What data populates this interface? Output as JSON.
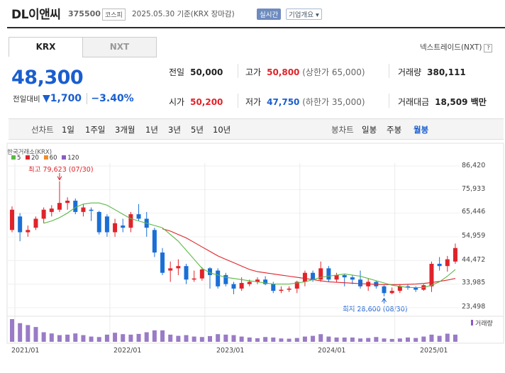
{
  "header": {
    "name": "DL이앤씨",
    "code": "375500",
    "market": "코스피",
    "date_text": "2025.05.30  기준(KRX 장마감)",
    "realtime_label": "실시간",
    "company_label": "기업개요 ▾"
  },
  "tabs": [
    {
      "label": "KRX"
    },
    {
      "label": "NXT"
    }
  ],
  "nxt_link": "넥스트레이드(NXT)",
  "nxt_link_icon": "?",
  "price": {
    "current": "48,300",
    "change_label": "전일대비",
    "change_arrow": "▼",
    "change_value": "1,700",
    "change_pct": "−3.40%"
  },
  "stats": {
    "prev_close": {
      "label": "전일",
      "value": "50,000"
    },
    "high": {
      "label": "고가",
      "value": "50,800",
      "sub": "(상한가 65,000)"
    },
    "volume": {
      "label": "거래량",
      "value": "380,111"
    },
    "open": {
      "label": "시가",
      "value": "50,200"
    },
    "low": {
      "label": "저가",
      "value": "47,750",
      "sub": "(하한가 35,000)"
    },
    "amount": {
      "label": "거래대금",
      "value": "18,509 백만"
    }
  },
  "toolbar": {
    "line_label": "선차트",
    "periods": [
      "1일",
      "1주일",
      "3개월",
      "1년",
      "3년",
      "5년",
      "10년"
    ],
    "candle_label": "봉차트",
    "candle_types": [
      "일봉",
      "주봉",
      "월봉"
    ],
    "selected_candle": "월봉"
  },
  "chart_data": {
    "type": "candlestick",
    "source_label": "한국거래소(KRX)",
    "ma_legend": [
      {
        "name": "5",
        "color": "#5ab946"
      },
      {
        "name": "20",
        "color": "#e0232a"
      },
      {
        "name": "60",
        "color": "#f08c2a"
      },
      {
        "name": "120",
        "color": "#8a5cc2"
      }
    ],
    "y_ticks": [
      "86,420",
      "75,933",
      "65,446",
      "54,959",
      "44,472",
      "33,985",
      "23,498"
    ],
    "ylim": [
      23498,
      86420
    ],
    "x_ticks": [
      "2021/01",
      "2022/01",
      "2023/01",
      "2024/01",
      "2025/01"
    ],
    "high_annotation": "최고 79,623 (07/30)",
    "low_annotation": "최저 28,600 (08/30)",
    "volume_label": "거래량",
    "up_color": "#e0232a",
    "down_color": "#1a6fd6",
    "candles": [
      {
        "o": 58000,
        "c": 67000,
        "h": 68500,
        "l": 57000
      },
      {
        "o": 64000,
        "c": 57000,
        "h": 65500,
        "l": 53000
      },
      {
        "o": 57000,
        "c": 58000,
        "h": 60000,
        "l": 55000
      },
      {
        "o": 59000,
        "c": 63000,
        "h": 64000,
        "l": 58000
      },
      {
        "o": 63000,
        "c": 67000,
        "h": 68000,
        "l": 61000
      },
      {
        "o": 66000,
        "c": 67500,
        "h": 69000,
        "l": 64000
      },
      {
        "o": 67000,
        "c": 70000,
        "h": 79623,
        "l": 66000
      },
      {
        "o": 70000,
        "c": 71000,
        "h": 72500,
        "l": 67000
      },
      {
        "o": 71000,
        "c": 66000,
        "h": 72000,
        "l": 65000
      },
      {
        "o": 66000,
        "c": 68000,
        "h": 69500,
        "l": 64000
      },
      {
        "o": 67000,
        "c": 66500,
        "h": 68000,
        "l": 62000
      },
      {
        "o": 66000,
        "c": 57000,
        "h": 66500,
        "l": 56000
      },
      {
        "o": 64000,
        "c": 57000,
        "h": 65000,
        "l": 55000
      },
      {
        "o": 57000,
        "c": 61000,
        "h": 63000,
        "l": 55000
      },
      {
        "o": 60000,
        "c": 59000,
        "h": 63000,
        "l": 57000
      },
      {
        "o": 59000,
        "c": 65000,
        "h": 66000,
        "l": 57000
      },
      {
        "o": 65000,
        "c": 63000,
        "h": 69500,
        "l": 62000
      },
      {
        "o": 63000,
        "c": 59000,
        "h": 66000,
        "l": 55000
      },
      {
        "o": 58000,
        "c": 48000,
        "h": 59000,
        "l": 46000
      },
      {
        "o": 48000,
        "c": 39000,
        "h": 50000,
        "l": 38000
      },
      {
        "o": 40000,
        "c": 41000,
        "h": 44000,
        "l": 35000
      },
      {
        "o": 41000,
        "c": 42000,
        "h": 45000,
        "l": 38000
      },
      {
        "o": 42000,
        "c": 36000,
        "h": 43000,
        "l": 34000
      },
      {
        "o": 36000,
        "c": 36500,
        "h": 40000,
        "l": 35000
      },
      {
        "o": 36500,
        "c": 40500,
        "h": 41500,
        "l": 35500
      },
      {
        "o": 41000,
        "c": 38000,
        "h": 41500,
        "l": 32000
      },
      {
        "o": 40000,
        "c": 33000,
        "h": 41000,
        "l": 32000
      },
      {
        "o": 38000,
        "c": 34000,
        "h": 39000,
        "l": 33000
      },
      {
        "o": 34000,
        "c": 32000,
        "h": 35000,
        "l": 29500
      },
      {
        "o": 32000,
        "c": 34500,
        "h": 37000,
        "l": 31000
      },
      {
        "o": 34000,
        "c": 35000,
        "h": 36000,
        "l": 33000
      },
      {
        "o": 35000,
        "c": 36000,
        "h": 37000,
        "l": 34000
      },
      {
        "o": 36000,
        "c": 34000,
        "h": 37500,
        "l": 33500
      },
      {
        "o": 34000,
        "c": 31000,
        "h": 35000,
        "l": 30000
      },
      {
        "o": 31000,
        "c": 31500,
        "h": 33000,
        "l": 30000
      },
      {
        "o": 31500,
        "c": 32000,
        "h": 33000,
        "l": 30500
      },
      {
        "o": 32000,
        "c": 35000,
        "h": 35500,
        "l": 30000
      },
      {
        "o": 35000,
        "c": 39000,
        "h": 40000,
        "l": 33000
      },
      {
        "o": 39000,
        "c": 36000,
        "h": 40000,
        "l": 35000
      },
      {
        "o": 36000,
        "c": 41000,
        "h": 44000,
        "l": 35000
      },
      {
        "o": 41000,
        "c": 36000,
        "h": 42000,
        "l": 35000
      },
      {
        "o": 36000,
        "c": 38000,
        "h": 39000,
        "l": 35000
      },
      {
        "o": 38000,
        "c": 37000,
        "h": 38500,
        "l": 33000
      },
      {
        "o": 37000,
        "c": 36000,
        "h": 38000,
        "l": 34000
      },
      {
        "o": 36000,
        "c": 33000,
        "h": 40000,
        "l": 32000
      },
      {
        "o": 33000,
        "c": 35000,
        "h": 36500,
        "l": 31000
      },
      {
        "o": 35000,
        "c": 33000,
        "h": 35500,
        "l": 32000
      },
      {
        "o": 33000,
        "c": 30000,
        "h": 33500,
        "l": 28600
      },
      {
        "o": 30000,
        "c": 31000,
        "h": 32500,
        "l": 29500
      },
      {
        "o": 31000,
        "c": 33000,
        "h": 34000,
        "l": 30000
      },
      {
        "o": 33000,
        "c": 32500,
        "h": 34000,
        "l": 31500
      },
      {
        "o": 32500,
        "c": 31500,
        "h": 33000,
        "l": 30500
      },
      {
        "o": 31500,
        "c": 33500,
        "h": 34000,
        "l": 31000
      },
      {
        "o": 33000,
        "c": 43000,
        "h": 44000,
        "l": 30500
      },
      {
        "o": 43000,
        "c": 42000,
        "h": 46000,
        "l": 40000
      },
      {
        "o": 42000,
        "c": 45000,
        "h": 46500,
        "l": 39500
      },
      {
        "o": 44000,
        "c": 50000,
        "h": 52000,
        "l": 43000
      }
    ],
    "ma5": [
      null,
      null,
      null,
      null,
      61000,
      62000,
      63500,
      65500,
      68000,
      69500,
      70000,
      70000,
      69000,
      67000,
      65000,
      63000,
      62000,
      61000,
      60000,
      59000,
      56000,
      53000,
      49000,
      45000,
      41000,
      39000,
      38000,
      37000,
      36500,
      36000,
      35500,
      35000,
      34500,
      34000,
      34000,
      34000,
      34500,
      35000,
      36000,
      37000,
      37500,
      38000,
      38500,
      38000,
      37500,
      36500,
      35500,
      34500,
      33500,
      33000,
      32500,
      32500,
      32500,
      33500,
      35000,
      37500,
      40500
    ],
    "ma20": [
      null,
      null,
      null,
      null,
      null,
      null,
      null,
      null,
      null,
      null,
      null,
      null,
      null,
      null,
      null,
      null,
      null,
      null,
      null,
      58500,
      57500,
      56000,
      54500,
      52500,
      50500,
      48500,
      46500,
      45000,
      43500,
      42000,
      40500,
      39500,
      39000,
      38500,
      38000,
      37500,
      37000,
      36500,
      36000,
      35500,
      35000,
      34800,
      34600,
      34400,
      34200,
      34000,
      33900,
      33800,
      33800,
      33800,
      33900,
      34000,
      34300,
      34700,
      35200,
      35800,
      36500
    ]
  },
  "volume_bars": [
    95,
    78,
    70,
    62,
    40,
    35,
    28,
    30,
    35,
    28,
    22,
    20,
    30,
    38,
    32,
    30,
    33,
    40,
    48,
    48,
    30,
    25,
    28,
    22,
    20,
    24,
    32,
    30,
    28,
    22,
    18,
    15,
    20,
    18,
    14,
    13,
    16,
    22,
    25,
    32,
    22,
    18,
    18,
    18,
    14,
    16,
    20,
    14,
    12,
    14,
    18,
    16,
    22,
    30,
    25,
    34,
    30
  ]
}
